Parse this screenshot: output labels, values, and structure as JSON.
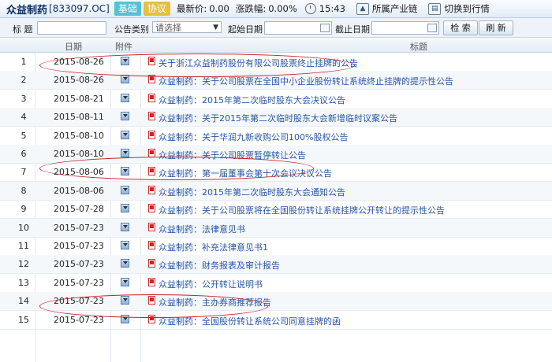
{
  "header": {
    "stock_name": "众益制药",
    "stock_code": "[833097.OC]",
    "tab_basic": "基础",
    "tab_protocol": "协议",
    "latest_price_label": "最新价:",
    "latest_price_value": "0.00",
    "change_label": "涨跌幅:",
    "change_value": "0.00%",
    "time": "15:43",
    "industry_chain": "所属产业链",
    "switch_quotes": "切换到行情"
  },
  "filter": {
    "title_label": "标 题",
    "type_label": "公告类别",
    "type_value": "请选择",
    "start_date_label": "起始日期",
    "end_date_label": "截止日期",
    "search_button": "检 索",
    "refresh_button": "刷 新"
  },
  "table": {
    "columns": {
      "date": "日期",
      "attachment": "附件",
      "title": "标题"
    },
    "rows": [
      {
        "num": "1",
        "date": "2015-08-26",
        "title": "关于浙江众益制药股份有限公司股票终止挂牌的公告"
      },
      {
        "num": "2",
        "date": "2015-08-26",
        "title": "众益制药：关于公司股票在全国中小企业股份转让系统终止挂牌的提示性公告"
      },
      {
        "num": "3",
        "date": "2015-08-21",
        "title": "众益制药：2015年第二次临时股东大会决议公告"
      },
      {
        "num": "4",
        "date": "2015-08-11",
        "title": "众益制药：关于2015年第二次临时股东大会新增临时议案公告"
      },
      {
        "num": "5",
        "date": "2015-08-10",
        "title": "众益制药：关于华润九新收购公司100%股权公告"
      },
      {
        "num": "6",
        "date": "2015-08-10",
        "title": "众益制药：关于公司股票暂停转让公告"
      },
      {
        "num": "7",
        "date": "2015-08-06",
        "title": "众益制药：第一届董事会第十次会议决议公告"
      },
      {
        "num": "8",
        "date": "2015-08-06",
        "title": "众益制药：2015年第二次临时股东大会通知公告"
      },
      {
        "num": "9",
        "date": "2015-07-28",
        "title": "众益制药：关于公司股票将在全国股份转让系统挂牌公开转让的提示性公告"
      },
      {
        "num": "10",
        "date": "2015-07-23",
        "title": "众益制药：法律意见书"
      },
      {
        "num": "11",
        "date": "2015-07-23",
        "title": "众益制药：补充法律意见书1"
      },
      {
        "num": "12",
        "date": "2015-07-23",
        "title": "众益制药：财务报表及审计报告"
      },
      {
        "num": "13",
        "date": "2015-07-23",
        "title": "众益制药：公开转让说明书"
      },
      {
        "num": "14",
        "date": "2015-07-23",
        "title": "众益制药：主办券商推荐报告"
      },
      {
        "num": "15",
        "date": "2015-07-23",
        "title": "众益制药：全国股份转让系统公司同意挂牌的函"
      }
    ]
  },
  "annotation_color": "#c8202a"
}
